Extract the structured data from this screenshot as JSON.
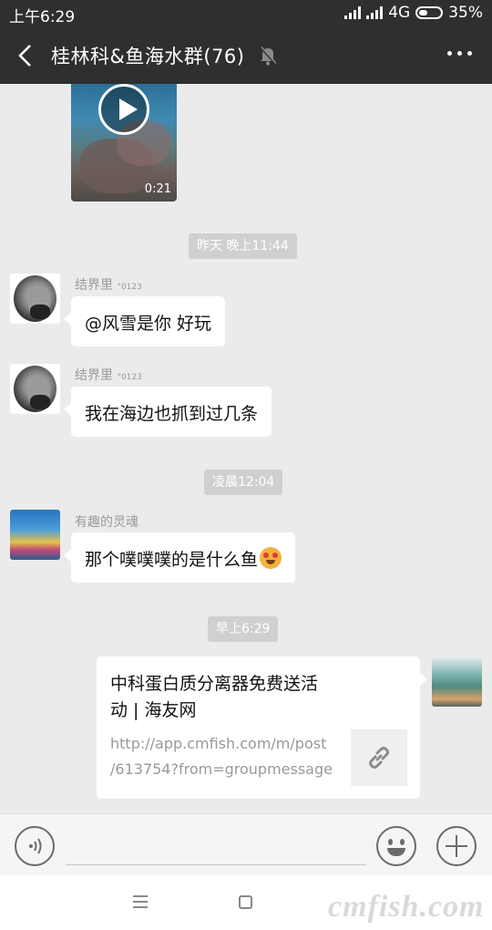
{
  "status_bar": {
    "time": "上午6:29",
    "network": "4G",
    "battery": "35%"
  },
  "header": {
    "title": "桂林科&鱼海水群(76)",
    "back_icon": "back-arrow-icon",
    "mute_icon": "muted-bell-icon",
    "more_icon": "more-dots-icon"
  },
  "messages": {
    "video": {
      "duration": "0:21"
    },
    "time1": "昨天 晚上11:44",
    "msg1": {
      "sender": "结界里",
      "sender_suffix": "°0123",
      "text": "@风雪是你  好玩"
    },
    "msg2": {
      "sender": "结界里",
      "sender_suffix": "°0123",
      "text": "我在海边也抓到过几条"
    },
    "time2": "凌晨12:04",
    "msg3": {
      "sender": "有趣的灵魂",
      "text": "那个噗噗噗的是什么鱼"
    },
    "time3": "早上6:29",
    "link": {
      "title_line1": "中科蛋白质分离器免费送活",
      "title_line2": "动 | 海友网",
      "url_line1": "http://app.cmfish.com/m/post",
      "url_line2": "/613754?from=groupmessage"
    }
  },
  "input_bar": {
    "voice_icon": "voice-icon",
    "emoji_icon": "emoji-icon",
    "plus_icon": "plus-icon"
  },
  "watermark": "cmfish.com"
}
